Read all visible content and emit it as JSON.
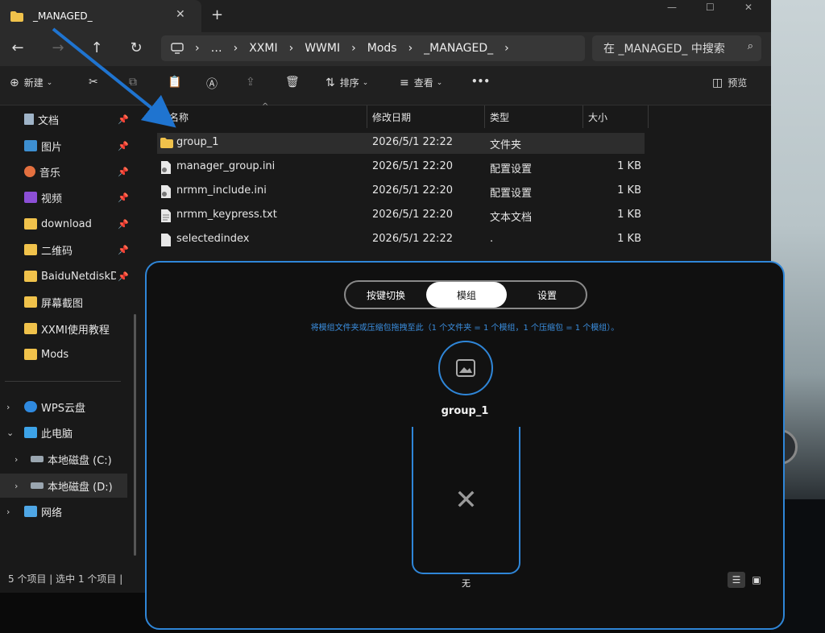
{
  "tab": {
    "title": "_MANAGED_"
  },
  "window_controls": {
    "minimize": "—",
    "maximize": "☐",
    "close": "✕"
  },
  "nav": {
    "back": "←",
    "forward": "→",
    "up": "↑",
    "refresh": "↻"
  },
  "address": {
    "crumbs": [
      "…",
      "XXMI",
      "WWMI",
      "Mods",
      "_MANAGED_"
    ]
  },
  "search": {
    "placeholder": "在 _MANAGED_ 中搜索"
  },
  "toolbar": {
    "new_label": "新建",
    "sort_label": "排序",
    "view_label": "查看",
    "more_label": "•••",
    "preview_label": "预览"
  },
  "sidebar": {
    "quick": [
      {
        "label": "文档",
        "icon": "document-icon"
      },
      {
        "label": "图片",
        "icon": "picture-icon"
      },
      {
        "label": "音乐",
        "icon": "music-icon"
      },
      {
        "label": "视频",
        "icon": "video-icon"
      },
      {
        "label": "download",
        "icon": "folder-icon"
      },
      {
        "label": "二维码",
        "icon": "folder-icon"
      },
      {
        "label": "BaiduNetdiskDc",
        "icon": "folder-icon"
      },
      {
        "label": "屏幕截图",
        "icon": "folder-icon"
      },
      {
        "label": "XXMI使用教程",
        "icon": "folder-icon"
      },
      {
        "label": "Mods",
        "icon": "folder-icon"
      }
    ],
    "tree": [
      {
        "label": "WPS云盘",
        "icon": "cloud-icon",
        "chevron": "›"
      },
      {
        "label": "此电脑",
        "icon": "pc-icon",
        "chevron": "⌄"
      },
      {
        "label": "本地磁盘 (C:)",
        "icon": "drive-icon",
        "chevron": "›"
      },
      {
        "label": "本地磁盘 (D:)",
        "icon": "drive-icon",
        "chevron": "›"
      },
      {
        "label": "网络",
        "icon": "network-icon",
        "chevron": "›"
      }
    ]
  },
  "status": {
    "items": "5 个项目",
    "selected": "选中 1 个项目"
  },
  "columns": {
    "name": "名称",
    "modified": "修改日期",
    "type": "类型",
    "size": "大小"
  },
  "files": [
    {
      "name": "group_1",
      "modified": "2026/5/1 22:22",
      "type": "文件夹",
      "size": "",
      "icon": "folder-icon",
      "selected": true
    },
    {
      "name": "manager_group.ini",
      "modified": "2026/5/1 22:20",
      "type": "配置设置",
      "size": "1 KB",
      "icon": "ini-file-icon"
    },
    {
      "name": "nrmm_include.ini",
      "modified": "2026/5/1 22:20",
      "type": "配置设置",
      "size": "1 KB",
      "icon": "ini-file-icon"
    },
    {
      "name": "nrmm_keypress.txt",
      "modified": "2026/5/1 22:20",
      "type": "文本文档",
      "size": "1 KB",
      "icon": "text-file-icon"
    },
    {
      "name": "selectedindex",
      "modified": "2026/5/1 22:22",
      "type": ".",
      "size": "1 KB",
      "icon": "blank-file-icon"
    }
  ],
  "overlay": {
    "tabs": [
      "按键切换",
      "模组",
      "设置"
    ],
    "active_tab": "模组",
    "hint": "将模组文件夹或压缩包拖拽至此（1 个文件夹 = 1 个模组，1 个压缩包 = 1 个模组）。",
    "group_name": "group_1",
    "card_symbol": "✕",
    "card_label": "无"
  },
  "colors": {
    "accent": "#2f86d8",
    "folder": "#f0c24b",
    "bg": "#191919"
  }
}
